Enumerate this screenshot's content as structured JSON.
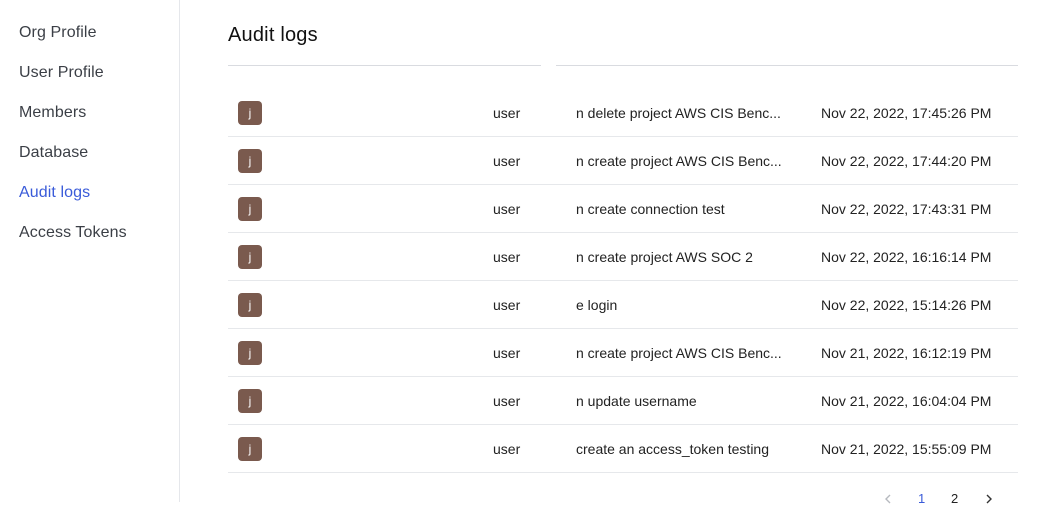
{
  "sidebar": {
    "items": [
      {
        "label": "Org Profile",
        "active": false
      },
      {
        "label": "User Profile",
        "active": false
      },
      {
        "label": "Members",
        "active": false
      },
      {
        "label": "Database",
        "active": false
      },
      {
        "label": "Audit logs",
        "active": true
      },
      {
        "label": "Access Tokens",
        "active": false
      }
    ]
  },
  "page": {
    "title": "Audit logs"
  },
  "logs": [
    {
      "avatar": "j",
      "user": "user",
      "action": "n delete project AWS CIS Benc...",
      "time": "Nov 22, 2022, 17:45:26 PM"
    },
    {
      "avatar": "j",
      "user": "user",
      "action": "n create project AWS CIS Benc...",
      "time": "Nov 22, 2022, 17:44:20 PM"
    },
    {
      "avatar": "j",
      "user": "user",
      "action": "n create connection test",
      "time": "Nov 22, 2022, 17:43:31 PM"
    },
    {
      "avatar": "j",
      "user": "user",
      "action": "n create project AWS SOC 2",
      "time": "Nov 22, 2022, 16:16:14 PM"
    },
    {
      "avatar": "j",
      "user": "user",
      "action": "e login",
      "time": "Nov 22, 2022, 15:14:26 PM"
    },
    {
      "avatar": "j",
      "user": "user",
      "action": "n create project AWS CIS Benc...",
      "time": "Nov 21, 2022, 16:12:19 PM"
    },
    {
      "avatar": "j",
      "user": "user",
      "action": "n update username",
      "time": "Nov 21, 2022, 16:04:04 PM"
    },
    {
      "avatar": "j",
      "user": "user",
      "action": "create an access_token testing",
      "time": "Nov 21, 2022, 15:55:09 PM"
    }
  ],
  "pagination": {
    "pages": [
      "1",
      "2"
    ],
    "current": "1"
  },
  "colors": {
    "accent": "#3a5bd9",
    "avatar_bg": "#7a5a4e",
    "divider": "#e6e8eb"
  },
  "icons": {
    "prev": "chevron-left-icon",
    "next": "chevron-right-icon"
  }
}
